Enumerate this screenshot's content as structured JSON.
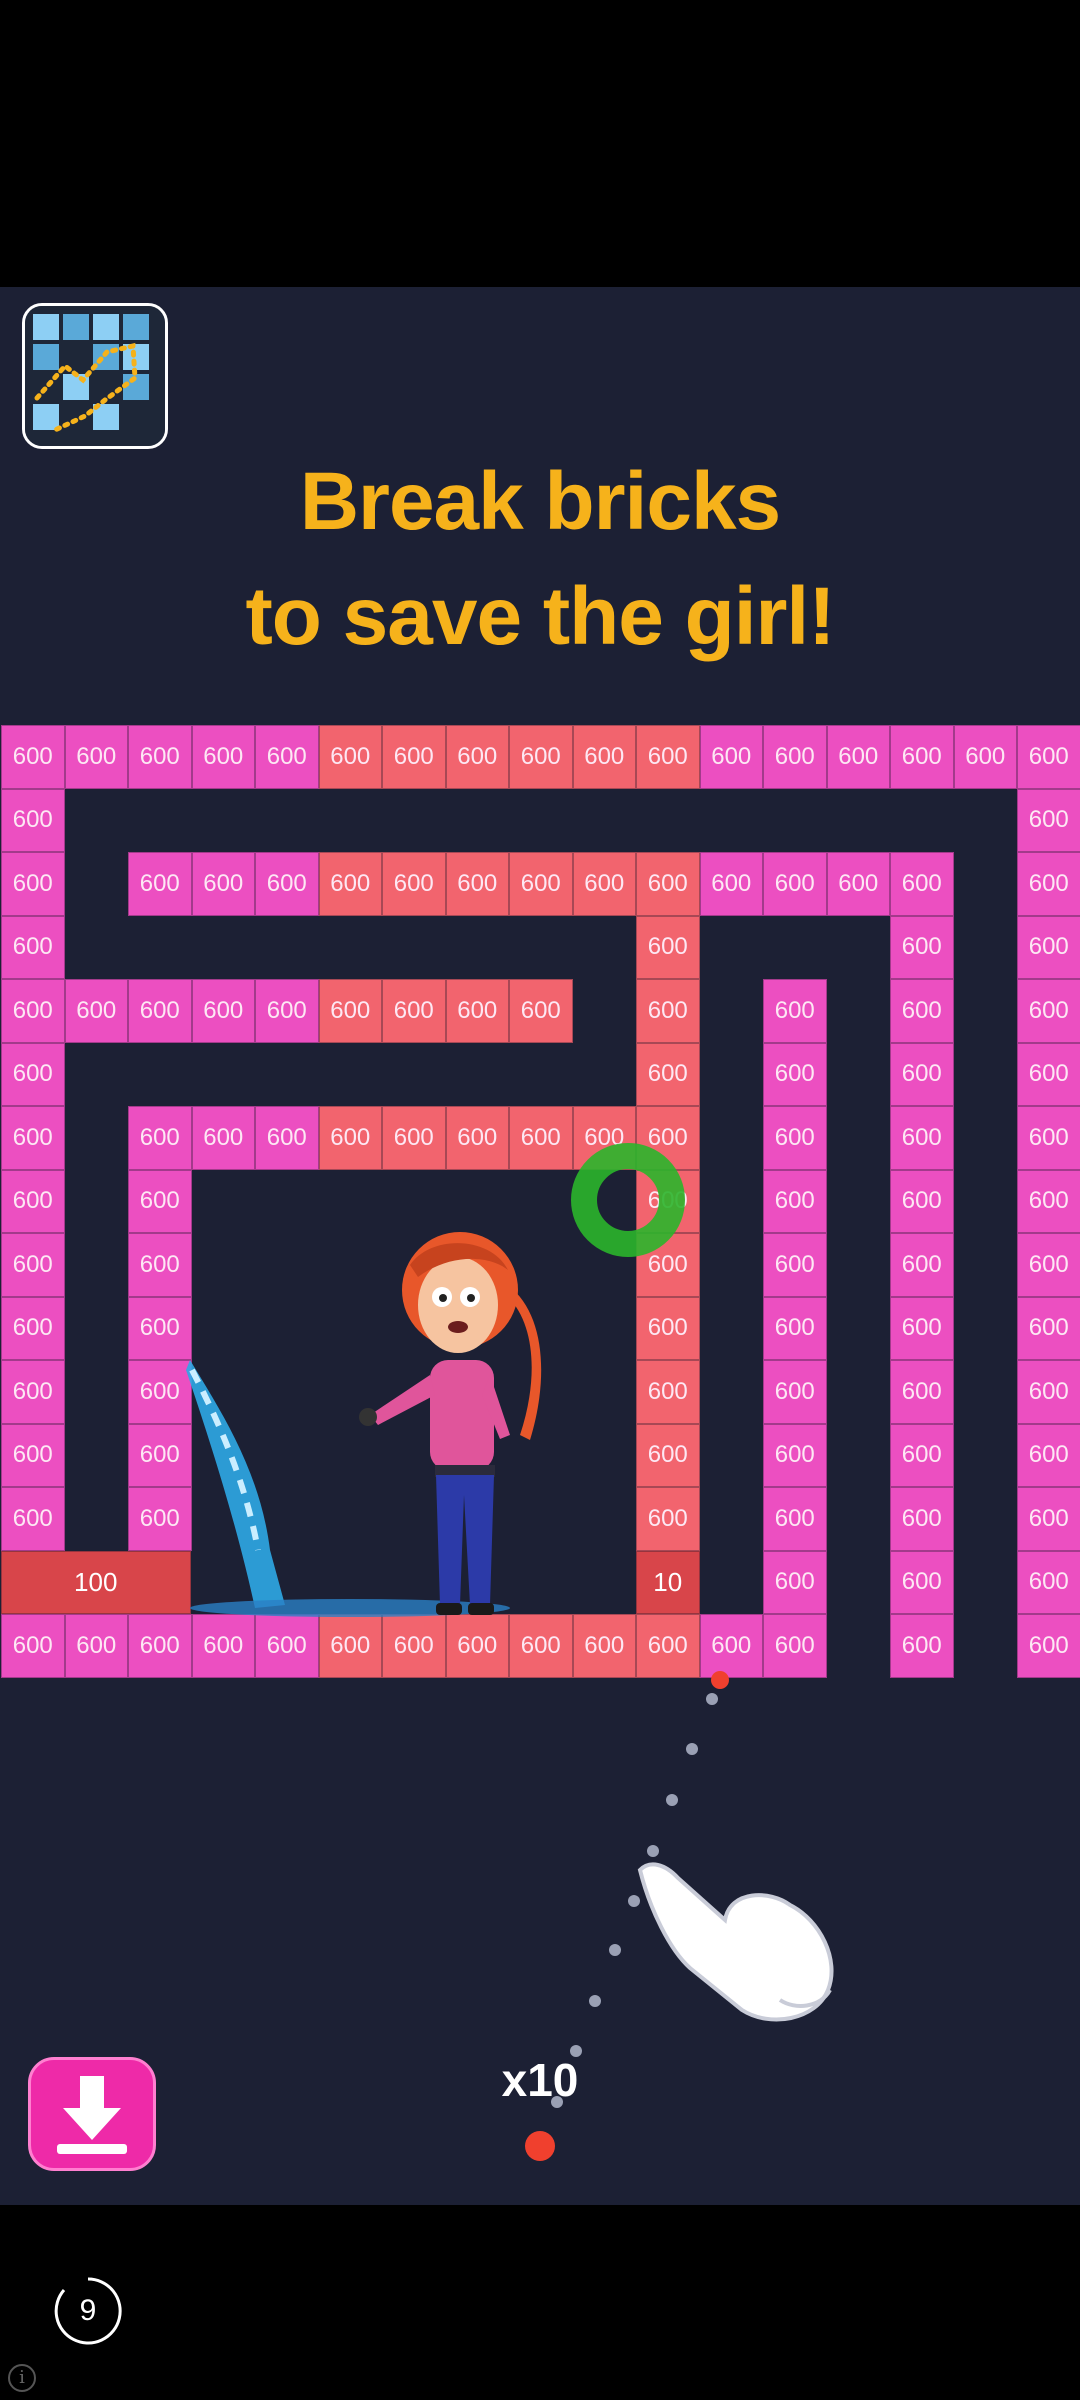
{
  "headline": {
    "line1": "Break bricks",
    "line2": "to save the girl!"
  },
  "brick_value": "600",
  "special_bricks": {
    "left_bar": "100",
    "small": "10"
  },
  "ball_count": "x10",
  "timer": "9",
  "icons": {
    "app": "bricks-game-app-icon",
    "download": "download-arrow-icon",
    "hand": "pointing-hand-icon",
    "ring": "green-ring-target",
    "info": "info-icon"
  },
  "colors": {
    "background": "#1c2034",
    "title": "#f6b21b",
    "brick_pink": "#ec4fc1",
    "brick_coral": "#f2646e",
    "brick_red": "#d8454a",
    "download_button": "#ee2aa8",
    "ball": "#f0402e"
  }
}
